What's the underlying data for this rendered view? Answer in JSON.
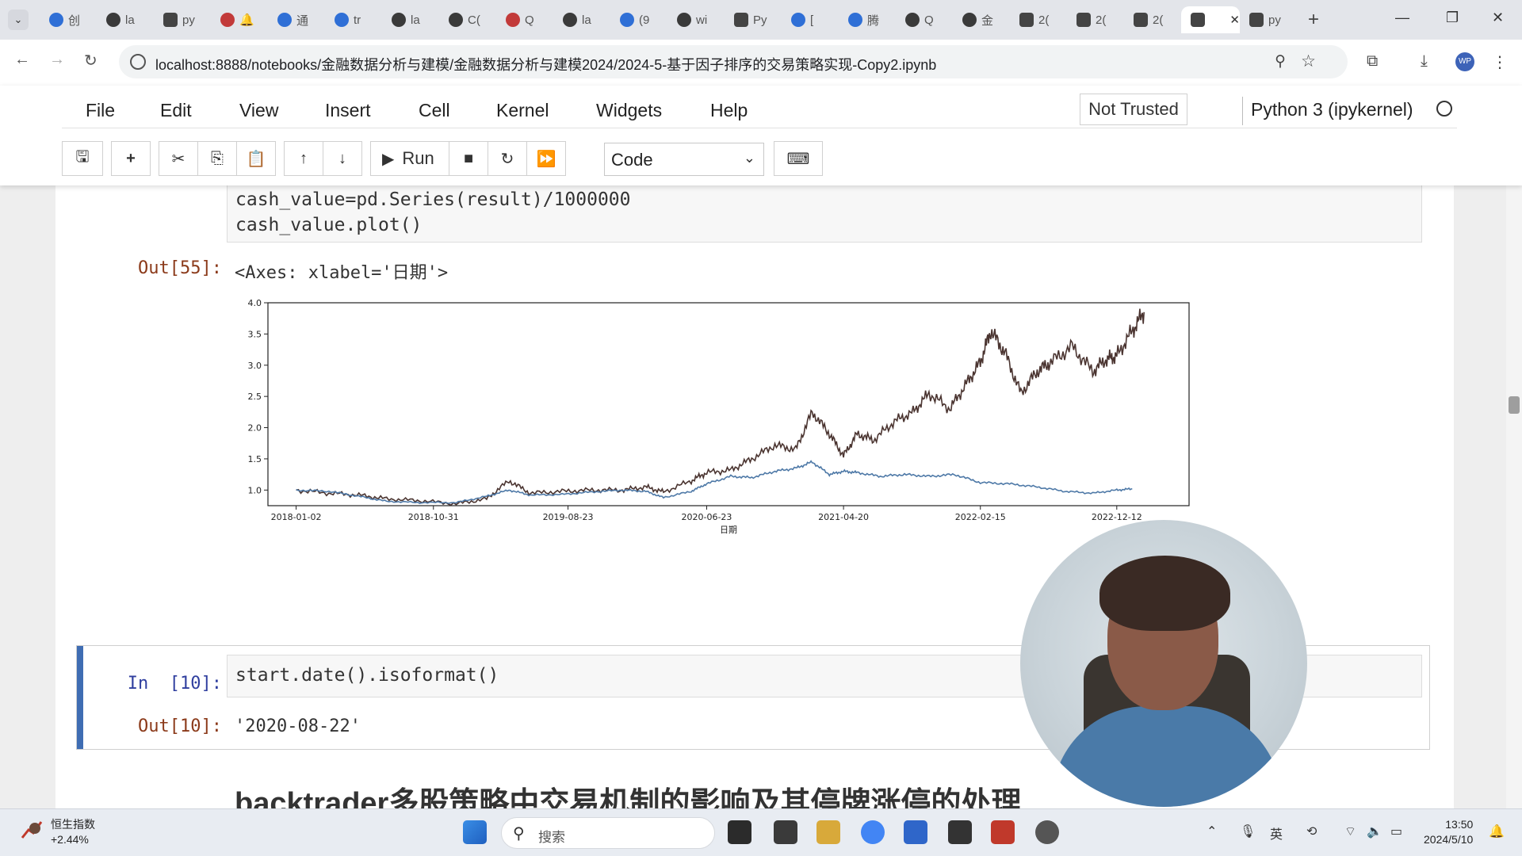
{
  "browser": {
    "tabs": [
      {
        "icon": "calendar-icon",
        "title": "创",
        "style": "bl"
      },
      {
        "icon": "github-icon",
        "title": "la",
        "style": ""
      },
      {
        "icon": "jupyter-icon",
        "title": "py",
        "style": "sq"
      },
      {
        "icon": "mail-icon",
        "title": "🔔",
        "style": "rd"
      },
      {
        "icon": "translate-icon",
        "title": "通",
        "style": "bl"
      },
      {
        "icon": "translate-icon",
        "title": "tr",
        "style": "bl"
      },
      {
        "icon": "github-icon",
        "title": "la",
        "style": ""
      },
      {
        "icon": "cube-icon",
        "title": "C(",
        "style": ""
      },
      {
        "icon": "mail-icon",
        "title": "Q",
        "style": "rd"
      },
      {
        "icon": "github-icon",
        "title": "la",
        "style": ""
      },
      {
        "icon": "zhihu-icon",
        "title": "(9",
        "style": "bl"
      },
      {
        "icon": "github-icon",
        "title": "wi",
        "style": ""
      },
      {
        "icon": "jupyter-icon",
        "title": "Py",
        "style": "sq"
      },
      {
        "icon": "cloud-icon",
        "title": "[",
        "style": "bl"
      },
      {
        "icon": "cloud-icon",
        "title": "腾",
        "style": "bl"
      },
      {
        "icon": "github-icon",
        "title": "Q",
        "style": ""
      },
      {
        "icon": "loading-icon",
        "title": "金",
        "style": ""
      },
      {
        "icon": "notebook-icon",
        "title": "2(",
        "style": "sq"
      },
      {
        "icon": "notebook-icon",
        "title": "2(",
        "style": "sq"
      },
      {
        "icon": "notebook-icon",
        "title": "2(",
        "style": "sq"
      }
    ],
    "active_tab": {
      "icon": "notebook-icon",
      "title": ""
    },
    "last_tab": {
      "icon": "jupyter-icon",
      "title": "py"
    },
    "url": "localhost:8888/notebooks/金融数据分析与建模/金融数据分析与建模2024/2024-5-基于因子排序的交易策略实现-Copy2.ipynb",
    "profile": "WP"
  },
  "jupyter": {
    "menu": [
      "File",
      "Edit",
      "View",
      "Insert",
      "Cell",
      "Kernel",
      "Widgets",
      "Help"
    ],
    "trusted": "Not Trusted",
    "kernel": "Python 3 (ipykernel)",
    "run_label": "Run",
    "cell_type": "Code"
  },
  "cells": {
    "cell55": {
      "code_line1": "cash_value=pd.Series(result)/1000000",
      "code_line2": "cash_value.plot()",
      "out_prompt": "Out[55]:",
      "out_text": "<Axes: xlabel='日期'>"
    },
    "cell10": {
      "in_prompt": "In  [10]:",
      "code": "start.date().isoformat()",
      "out_prompt": "Out[10]:",
      "out_text": "'2020-08-22'"
    },
    "heading": "backtrader多股策略中交易机制的影响及其停牌涨停的处理"
  },
  "chart_data": {
    "type": "line",
    "xlabel": "日期",
    "ylabel": "",
    "ylim": [
      0.75,
      4.0
    ],
    "x_tick_labels": [
      "2018-01-02",
      "2018-10-31",
      "2019-08-23",
      "2020-06-23",
      "2021-04-20",
      "2022-02-15",
      "2022-12-12"
    ],
    "y_ticks": [
      1.0,
      1.5,
      2.0,
      2.5,
      3.0,
      3.5,
      4.0
    ],
    "y_tick_labels": [
      "1.0",
      "1.5",
      "2.0",
      "2.5",
      "3.0",
      "3.5",
      "4.0"
    ],
    "grid": false,
    "series": [
      {
        "color": "#4a3430",
        "x": [
          "2018-01-02",
          "2018-03-15",
          "2018-05-20",
          "2018-07-20",
          "2018-10-01",
          "2018-12-20",
          "2019-02-25",
          "2019-04-15",
          "2019-06-01",
          "2019-08-10",
          "2019-10-15",
          "2019-12-20",
          "2020-02-10",
          "2020-03-20",
          "2020-05-20",
          "2020-06-23",
          "2020-08-15",
          "2020-09-30",
          "2020-11-20",
          "2021-01-05",
          "2021-02-10",
          "2021-03-20",
          "2021-04-20",
          "2021-05-20",
          "2021-06-25",
          "2021-08-10",
          "2021-09-20",
          "2021-10-25",
          "2021-12-10",
          "2022-01-15",
          "2022-02-15",
          "2022-03-10",
          "2022-04-10",
          "2022-05-15",
          "2022-06-20",
          "2022-07-20",
          "2022-09-05",
          "2022-10-20",
          "2022-11-20",
          "2022-12-12",
          "2023-01-15",
          "2023-02-10"
        ],
        "values": [
          1.0,
          0.95,
          0.92,
          0.86,
          0.83,
          0.78,
          0.86,
          1.15,
          0.95,
          0.98,
          1.0,
          1.0,
          1.05,
          0.97,
          1.15,
          1.28,
          1.32,
          1.5,
          1.72,
          1.65,
          2.25,
          1.9,
          1.55,
          1.9,
          1.8,
          2.1,
          2.25,
          2.55,
          2.3,
          2.7,
          3.05,
          3.55,
          3.2,
          2.55,
          2.9,
          3.05,
          3.3,
          2.9,
          3.1,
          3.15,
          3.55,
          3.85
        ]
      },
      {
        "color": "#4e79a7",
        "x": [
          "2018-01-02",
          "2018-03-15",
          "2018-05-20",
          "2018-07-20",
          "2018-10-01",
          "2018-12-20",
          "2019-02-25",
          "2019-04-15",
          "2019-06-01",
          "2019-08-10",
          "2019-10-15",
          "2019-12-20",
          "2020-02-10",
          "2020-03-20",
          "2020-05-20",
          "2020-06-23",
          "2020-08-15",
          "2020-09-30",
          "2020-11-20",
          "2021-01-05",
          "2021-02-10",
          "2021-03-20",
          "2021-04-20",
          "2021-05-20",
          "2021-07-10",
          "2021-09-01",
          "2021-10-25",
          "2021-12-20",
          "2022-02-15",
          "2022-04-20",
          "2022-06-20",
          "2022-08-20",
          "2022-10-20",
          "2022-12-12",
          "2023-01-15"
        ],
        "values": [
          1.0,
          0.98,
          0.9,
          0.82,
          0.8,
          0.8,
          0.9,
          1.0,
          0.92,
          0.93,
          0.97,
          1.0,
          0.98,
          0.88,
          0.98,
          1.1,
          1.22,
          1.2,
          1.3,
          1.35,
          1.45,
          1.25,
          1.3,
          1.28,
          1.22,
          1.25,
          1.22,
          1.25,
          1.12,
          1.1,
          1.05,
          0.98,
          0.95,
          1.0,
          1.02
        ]
      }
    ]
  },
  "taskbar": {
    "weather_title": "恒生指数",
    "weather_value": "+2.44%",
    "search": "搜索",
    "time": "13:50",
    "date": "2024/5/10"
  }
}
